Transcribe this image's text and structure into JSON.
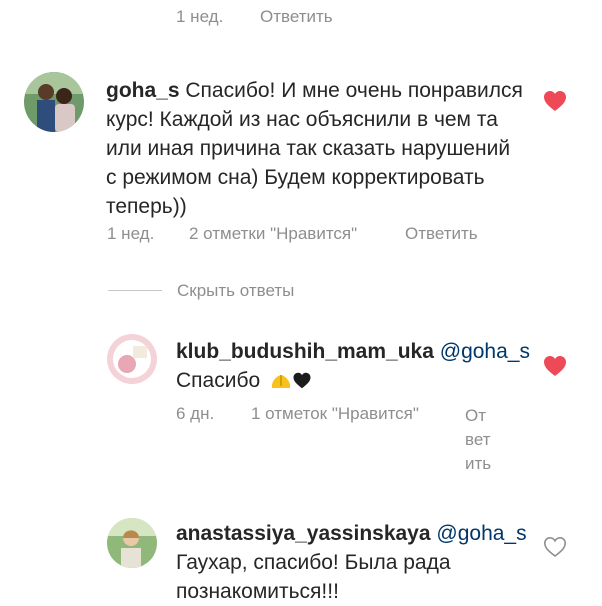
{
  "top_row": {
    "time": "1 нед.",
    "reply": "Ответить"
  },
  "comment1": {
    "username": "goha_s",
    "lines": [
      "Спасибо! И мне очень понравился",
      "курс! Каждой из нас объяснили в чем та",
      "или иная причина так сказать  нарушений",
      "с режимом сна) Будем корректировать",
      "теперь))"
    ],
    "time": "1 нед.",
    "likes": "2 отметки \"Нравится\"",
    "reply": "Ответить",
    "liked": true
  },
  "hide_replies": "Скрыть ответы",
  "reply1": {
    "username": "klub_budushih_mam_uka",
    "mention": "@goha_s",
    "text": "Спасибо",
    "time": "6 дн.",
    "likes": "1 отметок \"Нравится\"",
    "reply_parts": [
      "От",
      "вет",
      "ить"
    ],
    "liked": true
  },
  "reply2": {
    "username": "anastassiya_yassinskaya",
    "mention": "@goha_s",
    "lines": [
      "Гаухар, спасибо! Была рада",
      "познакомиться!!!"
    ],
    "liked": false
  },
  "colors": {
    "heart": "#ed4956",
    "meta": "#8e8e8e",
    "mention": "#00376b",
    "text": "#262626"
  }
}
